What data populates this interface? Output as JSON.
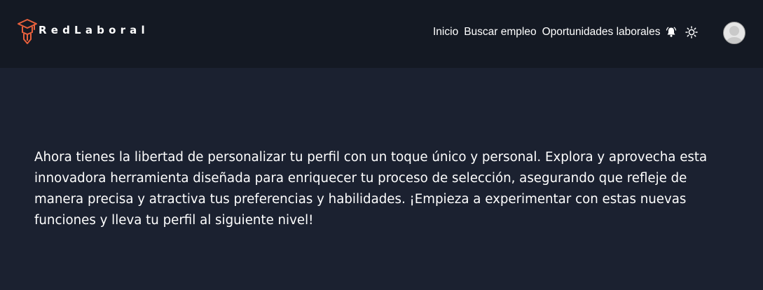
{
  "header": {
    "logo_text": "RedLaboral",
    "nav": [
      {
        "label": "Inicio"
      },
      {
        "label": "Buscar empleo"
      },
      {
        "label": "Oportunidades laborales"
      }
    ],
    "icons": [
      "bell-icon",
      "sun-icon",
      "avatar"
    ]
  },
  "main": {
    "paragraph": "Ahora tienes la libertad de personalizar tu perfil con un toque único y personal. Explora y aprovecha esta innovadora herramienta diseñada para enriquecer tu proceso de selección, asegurando que refleje de manera precisa y atractiva tus preferencias y habilidades. ¡Empieza a experimentar con estas nuevas funciones y lleva tu perfil al siguiente nivel!"
  },
  "colors": {
    "page_background": "#1b2130",
    "navbar_background": "#141923",
    "logo_accent": "#e8603c",
    "text": "#ffffff"
  }
}
